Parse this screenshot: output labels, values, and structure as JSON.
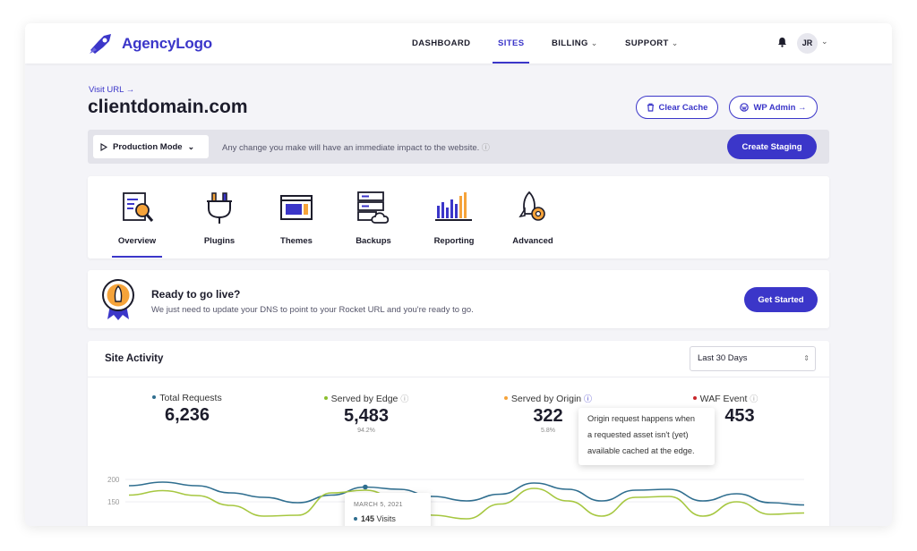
{
  "brand": {
    "name": "AgencyLogo",
    "accent": "#3b36c9"
  },
  "nav": {
    "items": [
      {
        "label": "DASHBOARD",
        "active": false,
        "has_dropdown": false
      },
      {
        "label": "SITES",
        "active": true,
        "has_dropdown": false
      },
      {
        "label": "BILLING",
        "active": false,
        "has_dropdown": true
      },
      {
        "label": "SUPPORT",
        "active": false,
        "has_dropdown": true
      }
    ],
    "user_initials": "JR",
    "icons": [
      "bell-icon",
      "chevron-down-icon"
    ]
  },
  "site": {
    "visit_url_label": "Visit URL →",
    "domain": "clientdomain.com",
    "clear_cache_label": "Clear Cache",
    "wp_admin_label": "WP Admin →"
  },
  "mode_bar": {
    "mode_label": "Production Mode",
    "note": "Any change you make will have an immediate impact to the website.",
    "create_staging_label": "Create Staging"
  },
  "tabs": [
    {
      "label": "Overview",
      "icon": "search-document-icon",
      "active": true
    },
    {
      "label": "Plugins",
      "icon": "plug-icon",
      "active": false
    },
    {
      "label": "Themes",
      "icon": "browser-window-icon",
      "active": false
    },
    {
      "label": "Backups",
      "icon": "server-cloud-icon",
      "active": false
    },
    {
      "label": "Reporting",
      "icon": "bar-chart-icon",
      "active": false
    },
    {
      "label": "Advanced",
      "icon": "rocket-gear-icon",
      "active": false
    }
  ],
  "golive": {
    "title": "Ready to go live?",
    "subtitle": "We just need to update your DNS to point to your Rocket URL and you're ready to go.",
    "button_label": "Get Started"
  },
  "activity": {
    "title": "Site Activity",
    "range_selected": "Last 30 Days",
    "stats": [
      {
        "label": "Total Requests",
        "value": "6,236",
        "pct": "",
        "color": "#2f6e8f"
      },
      {
        "label": "Served by Edge",
        "value": "5,483",
        "pct": "94.2%",
        "color": "#8bbf2e"
      },
      {
        "label": "Served by Origin",
        "value": "322",
        "pct": "5.8%",
        "color": "#f5a33a"
      },
      {
        "label": "WAF Event",
        "value": "453",
        "pct": "",
        "color": "#c8262b"
      }
    ],
    "tooltip": {
      "line1": "Origin request happens when",
      "line2": "a requested asset isn't (yet)",
      "line3": "available cached at the edge."
    },
    "chart_tooltip": {
      "date": "MARCH 5, 2021",
      "value": "145",
      "unit": "Visits"
    }
  },
  "chart_data": {
    "type": "line",
    "yticks": [
      "200",
      "150"
    ],
    "ylim": [
      100,
      200
    ],
    "series": [
      {
        "color": "#2f6e8f",
        "values": [
          186,
          194,
          186,
          170,
          160,
          148,
          165,
          183,
          178,
          162,
          152,
          167,
          192,
          178,
          152,
          176,
          178,
          152,
          168,
          148,
          143
        ]
      },
      {
        "color": "#a6c740",
        "values": [
          165,
          175,
          164,
          142,
          118,
          120,
          170,
          176,
          156,
          120,
          112,
          145,
          180,
          152,
          118,
          160,
          162,
          118,
          150,
          122,
          125
        ]
      }
    ],
    "highlight": {
      "series": 0,
      "index": 7
    }
  }
}
